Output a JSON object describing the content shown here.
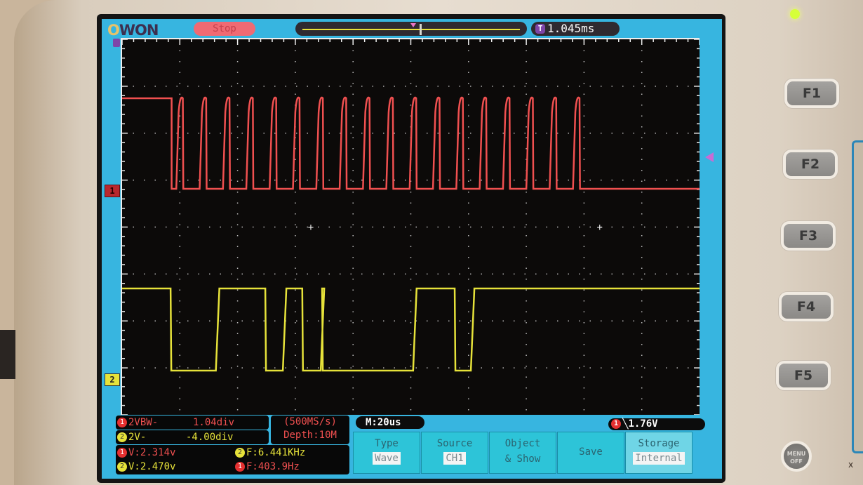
{
  "device": {
    "brand_logo": "OWON",
    "run_state": "Stop",
    "trigger_position": "1.045ms",
    "led_color": "#d6ff3a",
    "corner_mark": "x"
  },
  "channels": {
    "ch1": {
      "marker": "1",
      "color": "#f05050"
    },
    "ch2": {
      "marker": "2",
      "color": "#e6e23a"
    }
  },
  "measurements": {
    "ch1_vbw_label": "2VBW-",
    "ch1_vbw_value": "1.04div",
    "ch2_v_label": "2V-",
    "ch2_v_value": "-4.00div",
    "sample_rate": "(500MS/s)",
    "depth": "Depth:10M",
    "ch1_voltage": "V:2.314v",
    "ch2_freq": "F:6.441KHz",
    "ch2_voltage": "V:2.470v",
    "ch1_freq": "F:403.9Hz"
  },
  "timebase": "M:20us",
  "trigger": {
    "channel": "1",
    "edge": "falling",
    "level": "1.76V"
  },
  "menu": [
    {
      "title": "Type",
      "value": "Wave"
    },
    {
      "title": "Source",
      "value": "CH1"
    },
    {
      "title": "Object",
      "title2": "& Show"
    },
    {
      "title": "Save"
    },
    {
      "title": "Storage",
      "value": "Internal"
    }
  ],
  "fkeys": [
    "F1",
    "F2",
    "F3",
    "F4",
    "F5"
  ],
  "menu_off": {
    "line1": "MENU",
    "line2": "OFF"
  },
  "waveforms": {
    "ch1": {
      "description": "burst of 18 pulses after initial high, then low",
      "high_div": 1.0,
      "low_div": 0.0,
      "initial_high_until_div": 1.1,
      "pulse_count": 18,
      "burst_end_div": 7.6
    },
    "ch2": {
      "transitions_div": [
        [
          0,
          1
        ],
        [
          1.05,
          0
        ],
        [
          2.03,
          1
        ],
        [
          3.1,
          0
        ],
        [
          3.48,
          1
        ],
        [
          3.9,
          0
        ],
        [
          4.3,
          1
        ],
        [
          4.33,
          0
        ],
        [
          6.3,
          1
        ],
        [
          7.2,
          0
        ],
        [
          7.55,
          1
        ],
        [
          10.2,
          1
        ]
      ]
    }
  }
}
